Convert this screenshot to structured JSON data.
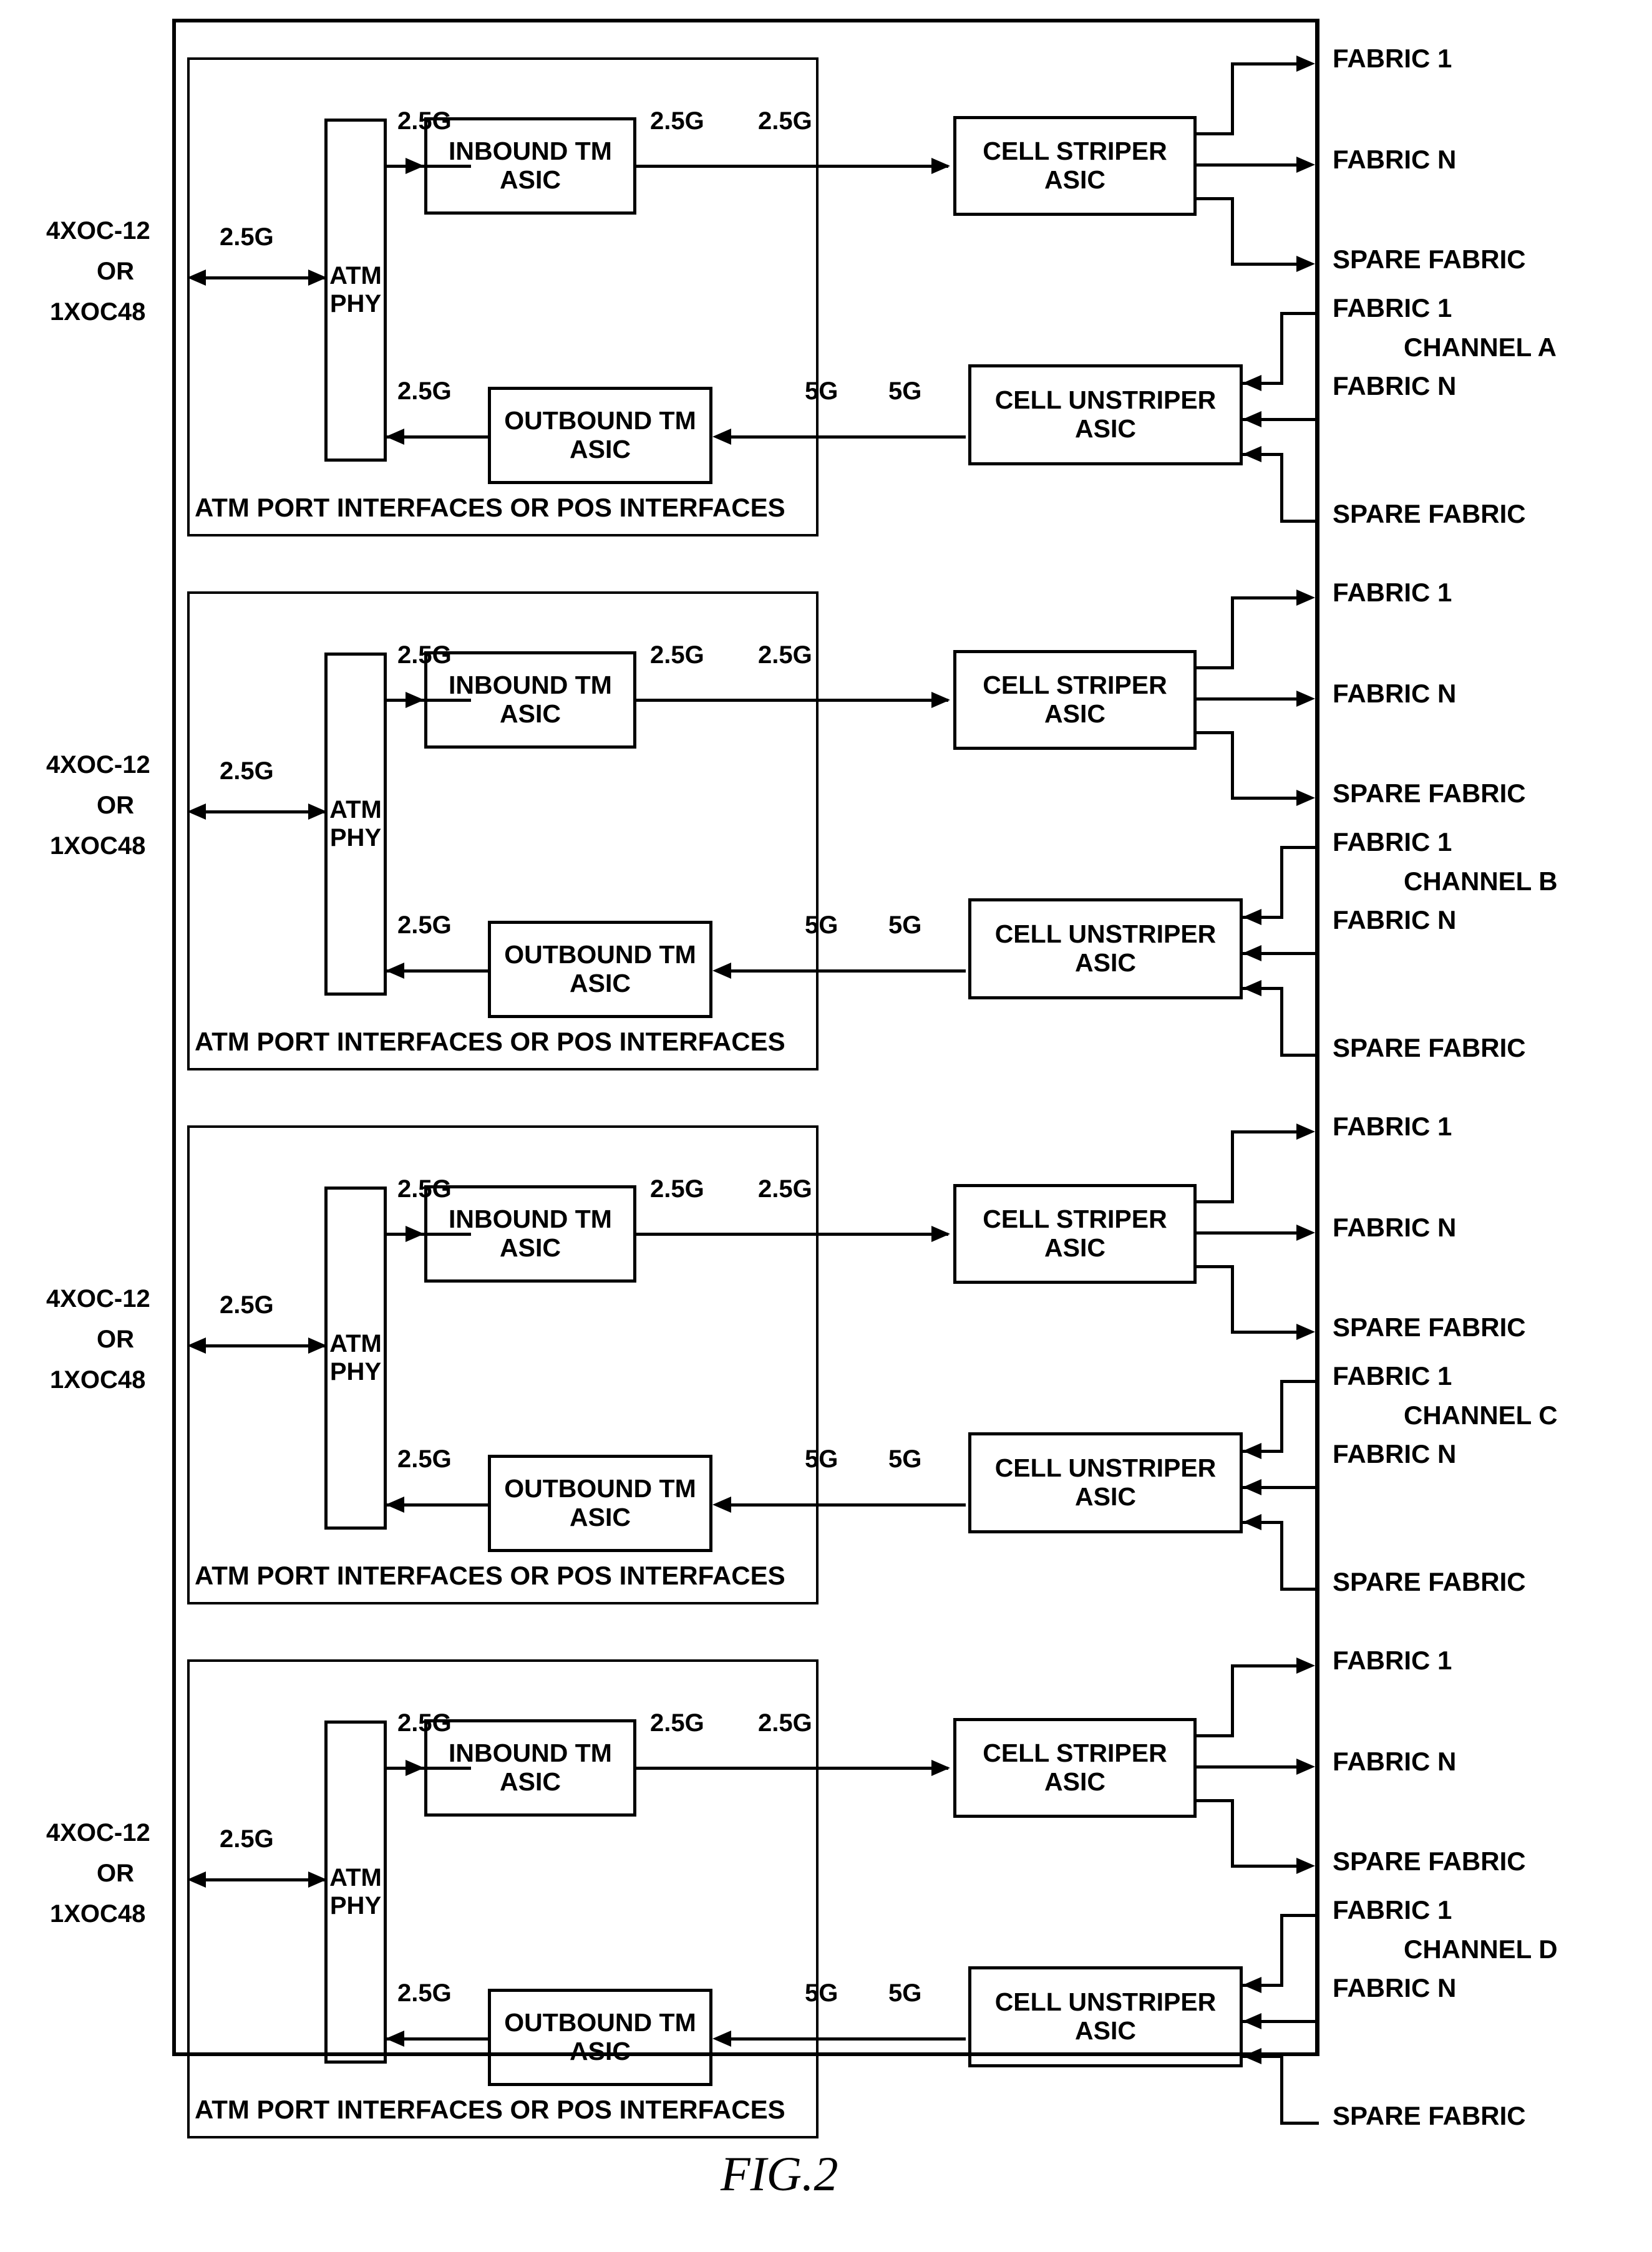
{
  "figure": {
    "label": "FIG.2"
  },
  "rates": {
    "line_rate": "2.5G",
    "phy_to_inbound": "2.5G",
    "inbound_out": "2.5G",
    "striper_in": "2.5G",
    "outbound_to_phy": "2.5G",
    "unstriper_out": "5G",
    "outbound_in": "5G"
  },
  "port_label": {
    "line1": "4XOC-12",
    "line2": "OR",
    "line3": "1XOC48"
  },
  "interfaces_caption": "ATM PORT INTERFACES OR POS INTERFACES",
  "blocks": {
    "phy": {
      "line1": "ATM",
      "line2": "PHY"
    },
    "inbound": {
      "line1": "INBOUND TM",
      "line2": "ASIC"
    },
    "outbound": {
      "line1": "OUTBOUND TM",
      "line2": "ASIC"
    },
    "striper": {
      "line1": "CELL STRIPER",
      "line2": "ASIC"
    },
    "unstriper": {
      "line1": "CELL UNSTRIPER",
      "line2": "ASIC"
    }
  },
  "fabric_labels": {
    "fabric_1": "FABRIC 1",
    "fabric_n": "FABRIC N",
    "spare_fabric": "SPARE FABRIC"
  },
  "channels": [
    {
      "id": "A",
      "name": "CHANNEL A"
    },
    {
      "id": "B",
      "name": "CHANNEL B"
    },
    {
      "id": "C",
      "name": "CHANNEL C"
    },
    {
      "id": "D",
      "name": "CHANNEL D"
    }
  ],
  "colors": {
    "ink": "#000000",
    "paper": "#ffffff"
  }
}
